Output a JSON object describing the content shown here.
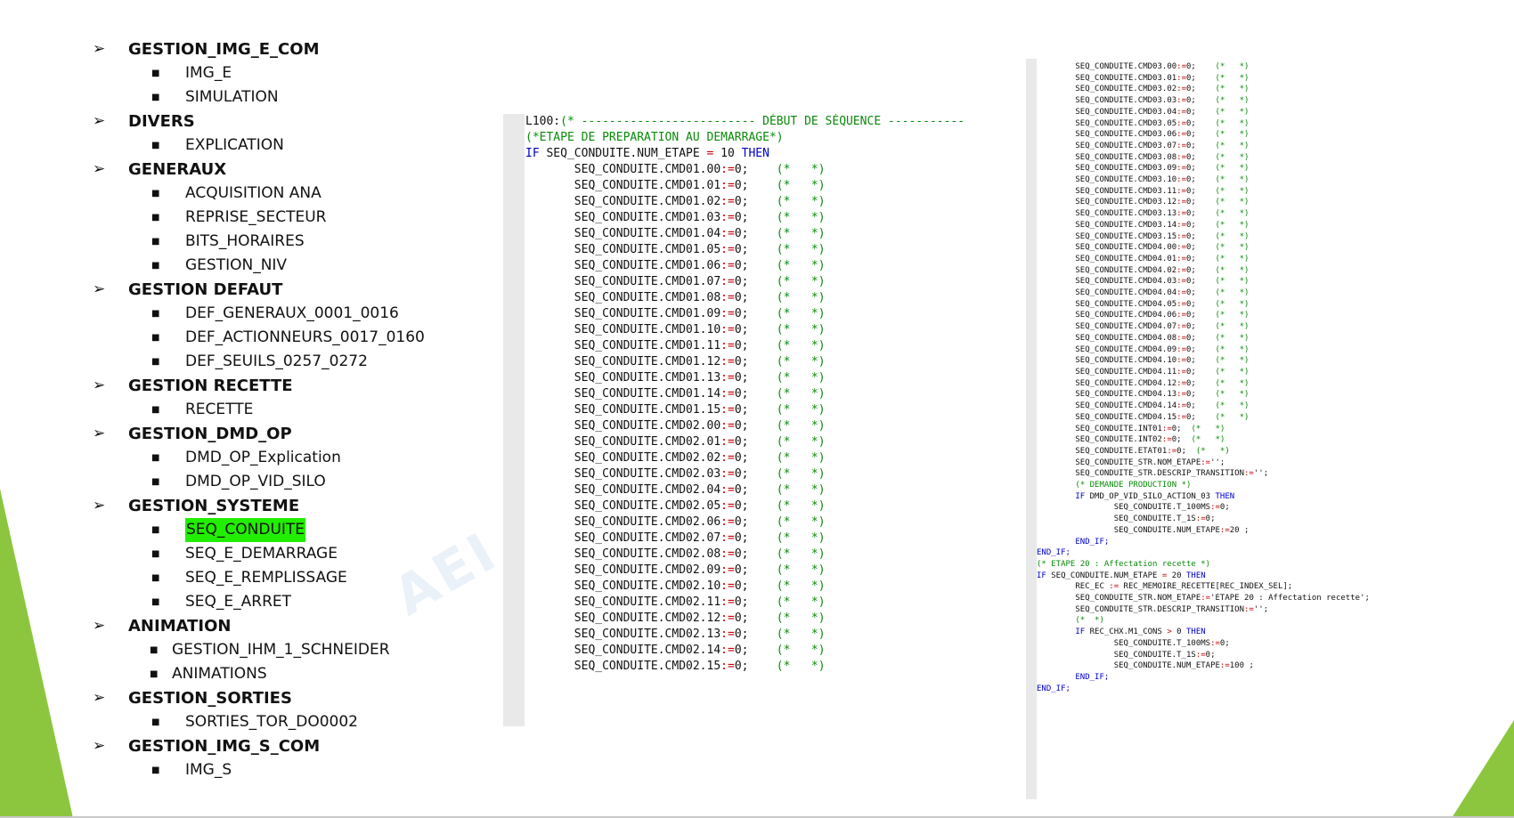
{
  "outline": [
    {
      "title": "GESTION_IMG_E_COM",
      "items": [
        "IMG_E",
        "SIMULATION"
      ]
    },
    {
      "title": "DIVERS",
      "items": [
        "EXPLICATION"
      ]
    },
    {
      "title": "GENERAUX",
      "items": [
        "ACQUISITION ANA",
        "REPRISE_SECTEUR",
        "BITS_HORAIRES",
        "GESTION_NIV"
      ]
    },
    {
      "title": "GESTION DEFAUT",
      "items": [
        "DEF_GENERAUX_0001_0016",
        "DEF_ACTIONNEURS_0017_0160",
        "DEF_SEUILS_0257_0272"
      ]
    },
    {
      "title": "GESTION RECETTE",
      "items": [
        "RECETTE"
      ]
    },
    {
      "title": "GESTION_DMD_OP",
      "items": [
        "DMD_OP_Explication",
        "DMD_OP_VID_SILO"
      ]
    },
    {
      "title": "GESTION_SYSTEME",
      "items": [
        "SEQ_CONDUITE",
        "SEQ_E_DEMARRAGE",
        "SEQ_E_REMPLISSAGE",
        "SEQ_E_ARRET"
      ],
      "highlight": "SEQ_CONDUITE"
    },
    {
      "title": "ANIMATION",
      "items": [
        "GESTION_IHM_1_SCHNEIDER",
        "ANIMATIONS"
      ],
      "indent": "shallow"
    },
    {
      "title": "GESTION_SORTIES",
      "items": [
        "SORTIES_TOR_DO0002"
      ]
    },
    {
      "title": "GESTION_IMG_S_COM",
      "items": [
        "IMG_S"
      ]
    }
  ],
  "watermark": "AEI",
  "code_mid_header": {
    "label": "L100:",
    "comment": "(* ------------------------- DÉBUT DE SÉQUENCE -----------",
    "etape_comment": "(*ETAPE DE PREPARATION AU DEMARRAGE*)",
    "if_line": {
      "kw_if": "IF",
      "var": "SEQ_CONDUITE.NUM_ETAPE",
      "op": "=",
      "val": "10",
      "kw_then": "THEN"
    }
  },
  "code_mid_blocks": [
    {
      "prefix": "SEQ_CONDUITE.CMD01.",
      "suffixes": [
        "00",
        "01",
        "02",
        "03",
        "04",
        "05",
        "06",
        "07",
        "08",
        "09",
        "10",
        "11",
        "12",
        "13",
        "14",
        "15"
      ]
    },
    {
      "prefix": "SEQ_CONDUITE.CMD02.",
      "suffixes": [
        "00",
        "01",
        "02",
        "03",
        "04",
        "05",
        "06",
        "07",
        "08",
        "09",
        "10",
        "11",
        "12",
        "13",
        "14",
        "15"
      ]
    }
  ],
  "code_right": {
    "block1": {
      "prefix": "SEQ_CONDUITE.CMD03.",
      "suffixes": [
        "00",
        "01",
        "02",
        "03",
        "04",
        "05",
        "06",
        "07",
        "08",
        "09",
        "10",
        "11",
        "12",
        "13",
        "14",
        "15"
      ]
    },
    "block2": {
      "prefix": "SEQ_CONDUITE.CMD04.",
      "suffixes": [
        "00",
        "01",
        "02",
        "03",
        "04",
        "05",
        "06",
        "07",
        "08",
        "09",
        "10",
        "11",
        "12",
        "13",
        "14",
        "15"
      ]
    },
    "lines_tail": [
      {
        "i": "        ",
        "t": [
          [
            "",
            "SEQ_CONDUITE.INT01"
          ],
          [
            "op",
            ":="
          ],
          [
            "",
            "0;  "
          ],
          [
            "cm",
            "(*   *)"
          ]
        ]
      },
      {
        "i": "        ",
        "t": [
          [
            "",
            "SEQ_CONDUITE.INT02"
          ],
          [
            "op",
            ":="
          ],
          [
            "",
            "0;  "
          ],
          [
            "cm",
            "(*   *)"
          ]
        ]
      },
      {
        "i": "",
        "t": []
      },
      {
        "i": "        ",
        "t": [
          [
            "",
            "SEQ_CONDUITE.ETAT01"
          ],
          [
            "op",
            ":="
          ],
          [
            "",
            "0;  "
          ],
          [
            "cm",
            "(*   *)"
          ]
        ]
      },
      {
        "i": "",
        "t": []
      },
      {
        "i": "        ",
        "t": [
          [
            "",
            "SEQ_CONDUITE_STR.NOM_ETAPE"
          ],
          [
            "op",
            ":="
          ],
          [
            "",
            "'';"
          ]
        ]
      },
      {
        "i": "        ",
        "t": [
          [
            "",
            "SEQ_CONDUITE_STR.DESCRIP_TRANSITION"
          ],
          [
            "op",
            ":="
          ],
          [
            "",
            "'';"
          ]
        ]
      },
      {
        "i": "",
        "t": []
      },
      {
        "i": "        ",
        "t": [
          [
            "cm",
            "(* DEMANDE PRODUCTION *)"
          ]
        ]
      },
      {
        "i": "        ",
        "t": [
          [
            "kw",
            "IF"
          ],
          [
            "",
            " DMD_OP_VID_SILO_ACTION_03 "
          ],
          [
            "kw",
            "THEN"
          ]
        ]
      },
      {
        "i": "                ",
        "t": [
          [
            "",
            "SEQ_CONDUITE.T_100MS"
          ],
          [
            "op",
            ":="
          ],
          [
            "",
            "0;"
          ]
        ]
      },
      {
        "i": "                ",
        "t": [
          [
            "",
            "SEQ_CONDUITE.T_1S"
          ],
          [
            "op",
            ":="
          ],
          [
            "",
            "0;"
          ]
        ]
      },
      {
        "i": "                ",
        "t": [
          [
            "",
            "SEQ_CONDUITE.NUM_ETAPE"
          ],
          [
            "op",
            ":="
          ],
          [
            "",
            "20 ;"
          ]
        ]
      },
      {
        "i": "        ",
        "t": [
          [
            "kw",
            "END_IF;"
          ]
        ]
      },
      {
        "i": "",
        "t": [
          [
            "kw",
            "END_IF;"
          ]
        ]
      },
      {
        "i": "",
        "t": []
      },
      {
        "i": "",
        "t": [
          [
            "cm",
            "(* ETAPE 20 : Affectation recette *)"
          ]
        ]
      },
      {
        "i": "",
        "t": [
          [
            "kw",
            "IF"
          ],
          [
            "",
            " SEQ_CONDUITE.NUM_ETAPE "
          ],
          [
            "op",
            "="
          ],
          [
            "",
            " 20 "
          ],
          [
            "kw",
            "THEN"
          ]
        ]
      },
      {
        "i": "",
        "t": []
      },
      {
        "i": "        ",
        "t": [
          [
            "",
            "REC_EC "
          ],
          [
            "op",
            ":="
          ],
          [
            "",
            " REC_MEMOIRE_RECETTE[REC_INDEX_SEL];"
          ]
        ]
      },
      {
        "i": "",
        "t": []
      },
      {
        "i": "        ",
        "t": [
          [
            "",
            "SEQ_CONDUITE_STR.NOM_ETAPE"
          ],
          [
            "op",
            ":="
          ],
          [
            "",
            "'ETAPE 20 : Affectation recette';"
          ]
        ]
      },
      {
        "i": "        ",
        "t": [
          [
            "",
            "SEQ_CONDUITE_STR.DESCRIP_TRANSITION"
          ],
          [
            "op",
            ":="
          ],
          [
            "",
            "'';"
          ]
        ]
      },
      {
        "i": "",
        "t": []
      },
      {
        "i": "        ",
        "t": [
          [
            "cm",
            "(*  *)"
          ]
        ]
      },
      {
        "i": "        ",
        "t": [
          [
            "kw",
            "IF"
          ],
          [
            "",
            " REC_CHX.M1_CONS "
          ],
          [
            "op",
            ">"
          ],
          [
            "",
            " 0 "
          ],
          [
            "kw",
            "THEN"
          ]
        ]
      },
      {
        "i": "                ",
        "t": [
          [
            "",
            "SEQ_CONDUITE.T_100MS"
          ],
          [
            "op",
            ":="
          ],
          [
            "",
            "0;"
          ]
        ]
      },
      {
        "i": "                ",
        "t": [
          [
            "",
            "SEQ_CONDUITE.T_1S"
          ],
          [
            "op",
            ":="
          ],
          [
            "",
            "0;"
          ]
        ]
      },
      {
        "i": "                ",
        "t": [
          [
            "",
            "SEQ_CONDUITE.NUM_ETAPE"
          ],
          [
            "op",
            ":="
          ],
          [
            "",
            "100 ;"
          ]
        ]
      },
      {
        "i": "        ",
        "t": [
          [
            "kw",
            "END_IF;"
          ]
        ]
      },
      {
        "i": "",
        "t": [
          [
            "kw",
            "END_IF;"
          ]
        ]
      }
    ]
  },
  "assign_op": ":=",
  "assign_val": "0;",
  "empty_comment": "(*   *)"
}
